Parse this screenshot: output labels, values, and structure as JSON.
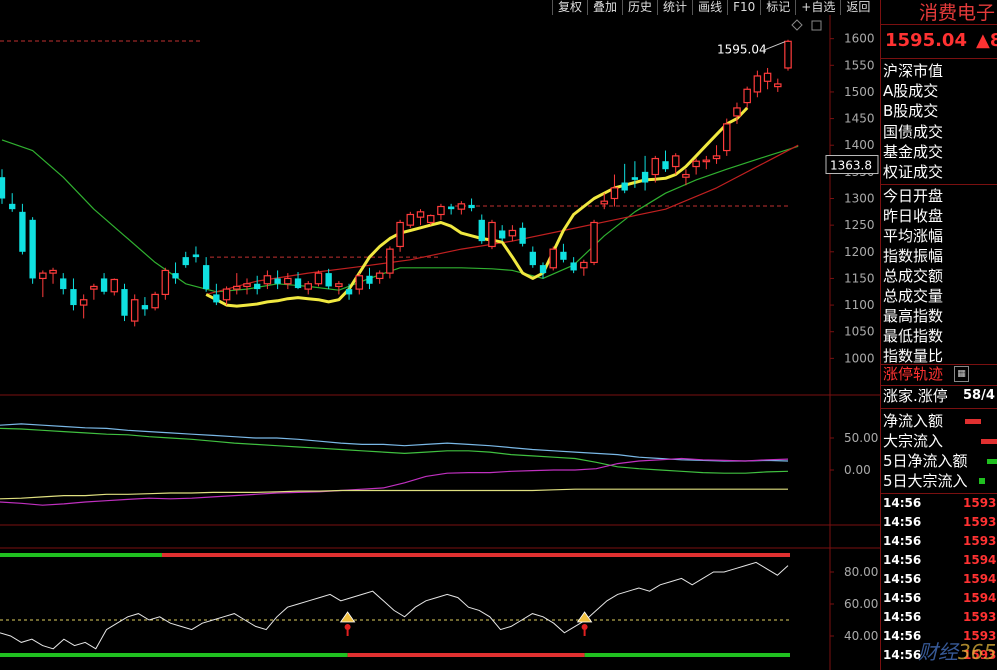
{
  "toolbar": [
    "复权",
    "叠加",
    "历史",
    "统计",
    "画线",
    "F10",
    "标记",
    "+自选",
    "返回"
  ],
  "stock": {
    "name": "消费电子",
    "price": "1595.04",
    "change": "▲8"
  },
  "indicators": [
    "沪深市值",
    "A股成交",
    "B股成交",
    "国债成交",
    "基金成交",
    "权证成交",
    "今日开盘",
    "昨日收盘",
    "平均涨幅",
    "指数振幅",
    "总成交额",
    "总成交量",
    "最高指数",
    "最低指数",
    "指数量比"
  ],
  "limit_track": "涨停轨迹",
  "limit_track_icon": "limit-track-icon",
  "limit_ratio": {
    "label": "涨家.涨停",
    "value": "58/4"
  },
  "flows": [
    {
      "label": "净流入额",
      "color": "#e03030"
    },
    {
      "label": "大宗流入",
      "color": "#e03030"
    },
    {
      "label": "5日净流入额",
      "color": "#20c020"
    },
    {
      "label": "5日大宗流入",
      "color": "#20c020"
    }
  ],
  "ticks": [
    {
      "time": "14:56",
      "price": "1593"
    },
    {
      "time": "14:56",
      "price": "1593"
    },
    {
      "time": "14:56",
      "price": "1593"
    },
    {
      "time": "14:56",
      "price": "1594"
    },
    {
      "time": "14:56",
      "price": "1594"
    },
    {
      "time": "14:56",
      "price": "1594"
    },
    {
      "time": "14:56",
      "price": "1593"
    },
    {
      "time": "14:56",
      "price": "1593"
    },
    {
      "time": "14:56",
      "price": "1593"
    }
  ],
  "watermark": {
    "text1": "财经",
    "text2": "365"
  },
  "chart_data": [
    {
      "type": "candlestick",
      "y_axis": {
        "min": 950,
        "max": 1620,
        "ticks": [
          1000,
          1050,
          1100,
          1150,
          1200,
          1250,
          1300,
          1350,
          1400,
          1450,
          1500,
          1550,
          1600
        ]
      },
      "last_price_label": "1595.04",
      "cursor_label": "1363.8",
      "dashed_levels": [
        1190,
        1286
      ],
      "candles": [
        {
          "o": 1340,
          "h": 1355,
          "l": 1290,
          "c": 1300
        },
        {
          "o": 1290,
          "h": 1310,
          "l": 1275,
          "c": 1280
        },
        {
          "o": 1275,
          "h": 1290,
          "l": 1195,
          "c": 1200
        },
        {
          "o": 1260,
          "h": 1265,
          "l": 1140,
          "c": 1150
        },
        {
          "o": 1150,
          "h": 1165,
          "l": 1115,
          "c": 1160
        },
        {
          "o": 1160,
          "h": 1170,
          "l": 1140,
          "c": 1165
        },
        {
          "o": 1150,
          "h": 1160,
          "l": 1120,
          "c": 1130
        },
        {
          "o": 1130,
          "h": 1150,
          "l": 1090,
          "c": 1100
        },
        {
          "o": 1100,
          "h": 1120,
          "l": 1075,
          "c": 1110
        },
        {
          "o": 1130,
          "h": 1140,
          "l": 1110,
          "c": 1135
        },
        {
          "o": 1150,
          "h": 1160,
          "l": 1120,
          "c": 1125
        },
        {
          "o": 1125,
          "h": 1150,
          "l": 1118,
          "c": 1148
        },
        {
          "o": 1130,
          "h": 1140,
          "l": 1070,
          "c": 1080
        },
        {
          "o": 1070,
          "h": 1120,
          "l": 1060,
          "c": 1110
        },
        {
          "o": 1100,
          "h": 1115,
          "l": 1080,
          "c": 1092
        },
        {
          "o": 1095,
          "h": 1125,
          "l": 1090,
          "c": 1120
        },
        {
          "o": 1120,
          "h": 1170,
          "l": 1110,
          "c": 1165
        },
        {
          "o": 1160,
          "h": 1180,
          "l": 1140,
          "c": 1150
        },
        {
          "o": 1190,
          "h": 1200,
          "l": 1170,
          "c": 1175
        },
        {
          "o": 1195,
          "h": 1210,
          "l": 1180,
          "c": 1190
        },
        {
          "o": 1175,
          "h": 1190,
          "l": 1125,
          "c": 1130
        },
        {
          "o": 1120,
          "h": 1140,
          "l": 1100,
          "c": 1105
        },
        {
          "o": 1110,
          "h": 1135,
          "l": 1100,
          "c": 1130
        },
        {
          "o": 1130,
          "h": 1160,
          "l": 1120,
          "c": 1135
        },
        {
          "o": 1135,
          "h": 1150,
          "l": 1120,
          "c": 1140
        },
        {
          "o": 1140,
          "h": 1155,
          "l": 1120,
          "c": 1130
        },
        {
          "o": 1140,
          "h": 1165,
          "l": 1130,
          "c": 1155
        },
        {
          "o": 1150,
          "h": 1165,
          "l": 1130,
          "c": 1140
        },
        {
          "o": 1140,
          "h": 1160,
          "l": 1130,
          "c": 1150
        },
        {
          "o": 1150,
          "h": 1162,
          "l": 1130,
          "c": 1132
        },
        {
          "o": 1130,
          "h": 1145,
          "l": 1120,
          "c": 1140
        },
        {
          "o": 1140,
          "h": 1165,
          "l": 1135,
          "c": 1160
        },
        {
          "o": 1160,
          "h": 1168,
          "l": 1130,
          "c": 1135
        },
        {
          "o": 1135,
          "h": 1145,
          "l": 1120,
          "c": 1140
        },
        {
          "o": 1130,
          "h": 1140,
          "l": 1110,
          "c": 1120
        },
        {
          "o": 1130,
          "h": 1160,
          "l": 1120,
          "c": 1155
        },
        {
          "o": 1155,
          "h": 1170,
          "l": 1130,
          "c": 1140
        },
        {
          "o": 1150,
          "h": 1165,
          "l": 1140,
          "c": 1160
        },
        {
          "o": 1160,
          "h": 1210,
          "l": 1150,
          "c": 1205
        },
        {
          "o": 1210,
          "h": 1260,
          "l": 1200,
          "c": 1255
        },
        {
          "o": 1250,
          "h": 1275,
          "l": 1245,
          "c": 1270
        },
        {
          "o": 1265,
          "h": 1280,
          "l": 1250,
          "c": 1275
        },
        {
          "o": 1255,
          "h": 1270,
          "l": 1250,
          "c": 1268
        },
        {
          "o": 1270,
          "h": 1290,
          "l": 1260,
          "c": 1285
        },
        {
          "o": 1285,
          "h": 1290,
          "l": 1270,
          "c": 1280
        },
        {
          "o": 1280,
          "h": 1295,
          "l": 1270,
          "c": 1290
        },
        {
          "o": 1288,
          "h": 1300,
          "l": 1276,
          "c": 1282
        },
        {
          "o": 1260,
          "h": 1270,
          "l": 1215,
          "c": 1220
        },
        {
          "o": 1210,
          "h": 1260,
          "l": 1205,
          "c": 1255
        },
        {
          "o": 1240,
          "h": 1250,
          "l": 1220,
          "c": 1225
        },
        {
          "o": 1230,
          "h": 1250,
          "l": 1220,
          "c": 1240
        },
        {
          "o": 1245,
          "h": 1255,
          "l": 1210,
          "c": 1215
        },
        {
          "o": 1200,
          "h": 1210,
          "l": 1170,
          "c": 1175
        },
        {
          "o": 1175,
          "h": 1180,
          "l": 1150,
          "c": 1160
        },
        {
          "o": 1170,
          "h": 1210,
          "l": 1165,
          "c": 1205
        },
        {
          "o": 1200,
          "h": 1215,
          "l": 1180,
          "c": 1185
        },
        {
          "o": 1180,
          "h": 1190,
          "l": 1160,
          "c": 1165
        },
        {
          "o": 1170,
          "h": 1185,
          "l": 1155,
          "c": 1180
        },
        {
          "o": 1180,
          "h": 1260,
          "l": 1175,
          "c": 1255
        },
        {
          "o": 1290,
          "h": 1310,
          "l": 1280,
          "c": 1295
        },
        {
          "o": 1300,
          "h": 1345,
          "l": 1285,
          "c": 1320
        },
        {
          "o": 1330,
          "h": 1365,
          "l": 1310,
          "c": 1315
        },
        {
          "o": 1340,
          "h": 1370,
          "l": 1320,
          "c": 1335
        },
        {
          "o": 1350,
          "h": 1380,
          "l": 1315,
          "c": 1330
        },
        {
          "o": 1345,
          "h": 1380,
          "l": 1330,
          "c": 1375
        },
        {
          "o": 1370,
          "h": 1390,
          "l": 1350,
          "c": 1355
        },
        {
          "o": 1360,
          "h": 1385,
          "l": 1345,
          "c": 1380
        },
        {
          "o": 1340,
          "h": 1355,
          "l": 1325,
          "c": 1345
        },
        {
          "o": 1360,
          "h": 1375,
          "l": 1345,
          "c": 1370
        },
        {
          "o": 1370,
          "h": 1380,
          "l": 1355,
          "c": 1372
        },
        {
          "o": 1375,
          "h": 1400,
          "l": 1365,
          "c": 1380
        },
        {
          "o": 1390,
          "h": 1450,
          "l": 1380,
          "c": 1440
        },
        {
          "o": 1455,
          "h": 1480,
          "l": 1440,
          "c": 1470
        },
        {
          "o": 1480,
          "h": 1510,
          "l": 1470,
          "c": 1505
        },
        {
          "o": 1500,
          "h": 1540,
          "l": 1490,
          "c": 1530
        },
        {
          "o": 1520,
          "h": 1545,
          "l": 1505,
          "c": 1535
        },
        {
          "o": 1510,
          "h": 1525,
          "l": 1500,
          "c": 1515
        },
        {
          "o": 1545,
          "h": 1598,
          "l": 1540,
          "c": 1595
        }
      ],
      "ma_yellow": [
        [
          20,
          1120
        ],
        [
          21,
          1110
        ],
        [
          22,
          1100
        ],
        [
          23,
          1098
        ],
        [
          24,
          1100
        ],
        [
          25,
          1102
        ],
        [
          26,
          1106
        ],
        [
          27,
          1108
        ],
        [
          28,
          1112
        ],
        [
          29,
          1114
        ],
        [
          30,
          1112
        ],
        [
          31,
          1110
        ],
        [
          32,
          1106
        ],
        [
          33,
          1110
        ],
        [
          34,
          1130
        ],
        [
          35,
          1160
        ],
        [
          36,
          1190
        ],
        [
          37,
          1210
        ],
        [
          38,
          1225
        ],
        [
          39,
          1235
        ],
        [
          40,
          1240
        ],
        [
          41,
          1245
        ],
        [
          42,
          1250
        ],
        [
          43,
          1255
        ],
        [
          44,
          1248
        ],
        [
          45,
          1235
        ],
        [
          46,
          1230
        ],
        [
          47,
          1225
        ],
        [
          48,
          1222
        ],
        [
          49,
          1218
        ],
        [
          50,
          1190
        ],
        [
          51,
          1160
        ],
        [
          52,
          1150
        ],
        [
          53,
          1160
        ],
        [
          54,
          1200
        ],
        [
          55,
          1240
        ],
        [
          56,
          1270
        ],
        [
          57,
          1285
        ],
        [
          58,
          1300
        ],
        [
          59,
          1310
        ],
        [
          60,
          1320
        ],
        [
          61,
          1325
        ],
        [
          62,
          1330
        ],
        [
          63,
          1335
        ],
        [
          64,
          1336
        ],
        [
          65,
          1338
        ],
        [
          66,
          1345
        ],
        [
          67,
          1360
        ],
        [
          68,
          1380
        ],
        [
          69,
          1400
        ],
        [
          70,
          1420
        ],
        [
          71,
          1440
        ],
        [
          72,
          1450
        ],
        [
          73,
          1470
        ]
      ],
      "ma_green": [
        [
          0,
          1410
        ],
        [
          3,
          1390
        ],
        [
          6,
          1340
        ],
        [
          9,
          1280
        ],
        [
          12,
          1230
        ],
        [
          15,
          1180
        ],
        [
          18,
          1140
        ],
        [
          21,
          1125
        ],
        [
          24,
          1130
        ],
        [
          27,
          1140
        ],
        [
          30,
          1135
        ],
        [
          33,
          1128
        ],
        [
          36,
          1150
        ],
        [
          39,
          1170
        ],
        [
          42,
          1170
        ],
        [
          45,
          1170
        ],
        [
          48,
          1168
        ],
        [
          50,
          1165
        ],
        [
          53,
          1150
        ],
        [
          56,
          1175
        ],
        [
          59,
          1230
        ],
        [
          62,
          1275
        ],
        [
          65,
          1310
        ],
        [
          68,
          1335
        ],
        [
          71,
          1355
        ],
        [
          75,
          1380
        ],
        [
          78,
          1398
        ]
      ],
      "ma_red": [
        [
          20,
          1120
        ],
        [
          25,
          1145
        ],
        [
          30,
          1160
        ],
        [
          35,
          1172
        ],
        [
          40,
          1185
        ],
        [
          45,
          1205
        ],
        [
          50,
          1220
        ],
        [
          55,
          1240
        ],
        [
          60,
          1260
        ],
        [
          65,
          1280
        ],
        [
          70,
          1320
        ],
        [
          75,
          1370
        ],
        [
          78,
          1400
        ]
      ]
    },
    {
      "type": "line",
      "y_axis": {
        "ticks": [
          50,
          0
        ]
      },
      "series": [
        {
          "color": "#7ab8e6",
          "values": [
            70,
            72,
            70,
            68,
            66,
            65,
            62,
            60,
            58,
            56,
            54,
            52,
            50,
            50,
            48,
            45,
            42,
            40,
            40,
            38,
            40,
            42,
            40,
            38,
            35,
            32,
            30,
            28,
            26,
            24,
            20,
            18,
            16,
            15,
            14,
            14,
            15,
            14
          ]
        },
        {
          "color": "#40c040",
          "values": [
            65,
            64,
            62,
            60,
            58,
            56,
            55,
            52,
            50,
            48,
            45,
            42,
            40,
            38,
            36,
            34,
            32,
            30,
            28,
            26,
            28,
            30,
            30,
            28,
            24,
            22,
            20,
            18,
            12,
            5,
            2,
            0,
            -2,
            -4,
            -5,
            -5,
            -3,
            -2
          ]
        },
        {
          "color": "#c030c0",
          "values": [
            -50,
            -52,
            -55,
            -53,
            -50,
            -48,
            -46,
            -44,
            -45,
            -44,
            -42,
            -40,
            -38,
            -36,
            -35,
            -34,
            -32,
            -30,
            -28,
            -20,
            -10,
            -5,
            -4,
            -4,
            -2,
            -1,
            0,
            0,
            2,
            10,
            14,
            16,
            18,
            16,
            15,
            14,
            16,
            17
          ]
        },
        {
          "color": "#e0e080",
          "values": [
            -45,
            -44,
            -42,
            -40,
            -40,
            -38,
            -38,
            -37,
            -36,
            -36,
            -35,
            -35,
            -35,
            -34,
            -33,
            -33,
            -32,
            -32,
            -32,
            -32,
            -32,
            -32,
            -32,
            -32,
            -32,
            -32,
            -31,
            -30,
            -30,
            -30,
            -30,
            -30,
            -30,
            -30,
            -30,
            -30,
            -30,
            -30
          ]
        }
      ]
    },
    {
      "type": "line",
      "y_axis": {
        "min": 30,
        "max": 90,
        "ticks": [
          80,
          60,
          40
        ]
      },
      "level": 50,
      "series": [
        {
          "color": "#e6e6e6",
          "values": [
            42,
            40,
            36,
            38,
            34,
            32,
            38,
            34,
            36,
            32,
            44,
            48,
            52,
            54,
            50,
            52,
            48,
            46,
            44,
            48,
            50,
            52,
            54,
            50,
            46,
            44,
            52,
            58,
            60,
            62,
            64,
            66,
            62,
            64,
            66,
            68,
            62,
            56,
            52,
            58,
            62,
            64,
            66,
            64,
            58,
            56,
            52,
            44,
            46,
            50,
            54,
            52,
            48,
            42,
            46,
            50,
            56,
            62,
            66,
            68,
            70,
            68,
            72,
            74,
            76,
            72,
            76,
            80,
            80,
            82,
            84,
            86,
            82,
            78,
            84
          ]
        }
      ],
      "band": [
        {
          "color": "#20c020",
          "from": 0.0,
          "to": 0.205
        },
        {
          "color": "#e03030",
          "from": 0.205,
          "to": 1.0
        }
      ],
      "band_bottom": [
        {
          "color": "#20c020",
          "from": 0.0,
          "to": 0.44
        },
        {
          "color": "#e03030",
          "from": 0.44,
          "to": 0.74
        },
        {
          "color": "#20c020",
          "from": 0.74,
          "to": 1.0
        }
      ],
      "signals": [
        44,
        74
      ]
    }
  ]
}
